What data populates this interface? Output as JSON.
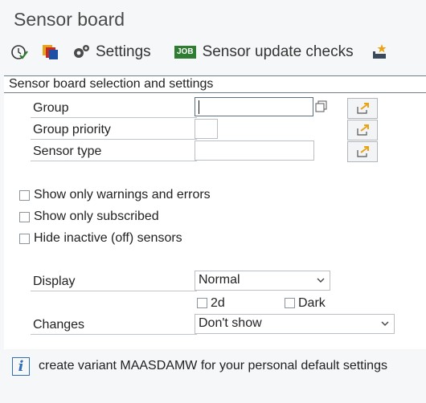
{
  "window": {
    "title": "Sensor board"
  },
  "toolbar": {
    "settings_label": "Settings",
    "sensor_update_label": "Sensor update checks",
    "job_badge": "JOB"
  },
  "panel": {
    "title": "Sensor board selection and settings",
    "fields": {
      "group_label": "Group",
      "group_value": "",
      "group_priority_label": "Group priority",
      "group_priority_value": "",
      "sensor_type_label": "Sensor type",
      "sensor_type_value": ""
    },
    "checkboxes": {
      "warnings_label": "Show only warnings and errors",
      "warnings_checked": false,
      "subscribed_label": "Show only subscribed",
      "subscribed_checked": false,
      "hide_inactive_label": "Hide inactive (off) sensors",
      "hide_inactive_checked": false
    },
    "display": {
      "label": "Display",
      "selected": "Normal",
      "option_2d_label": "2d",
      "option_2d_checked": false,
      "option_dark_label": "Dark",
      "option_dark_checked": false
    },
    "changes": {
      "label": "Changes",
      "selected": "Don't show"
    }
  },
  "info": {
    "icon": "info-icon",
    "text": "create variant MAASDAMW for your personal default settings"
  },
  "colors": {
    "accent_blue": "#2f6db5",
    "job_green": "#2e7d32",
    "icon_orange": "#e8a317"
  }
}
